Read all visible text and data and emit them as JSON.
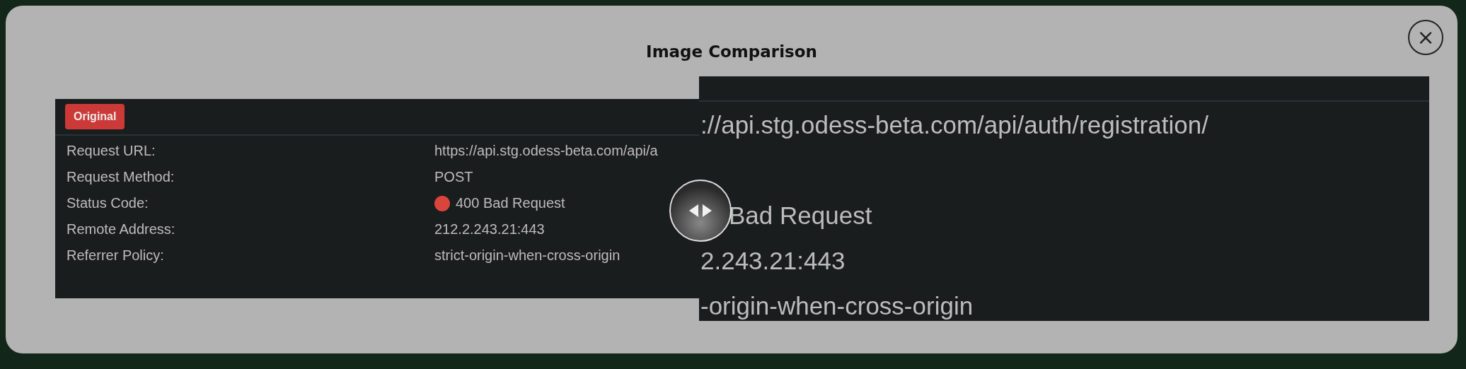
{
  "dialog": {
    "title": "Image Comparison",
    "close": "×"
  },
  "original": {
    "badge": "Original",
    "rows": [
      {
        "label": "Request URL:",
        "value": "https://api.stg.odess-beta.com/api/a"
      },
      {
        "label": "Request Method:",
        "value": "POST"
      },
      {
        "label": "Status Code:",
        "value": "400 Bad Request",
        "color": "#d9443c"
      },
      {
        "label": "Remote Address:",
        "value": "212.2.243.21:443"
      },
      {
        "label": "Referrer Policy:",
        "value": "strict-origin-when-cross-origin"
      }
    ]
  },
  "zoomed": {
    "lines": [
      {
        "text": "://api.stg.odess-beta.com/api/auth/registration/"
      },
      {
        "text": "Bad Request"
      },
      {
        "text": "2.243.21:443"
      },
      {
        "text": "-origin-when-cross-origin"
      }
    ]
  }
}
